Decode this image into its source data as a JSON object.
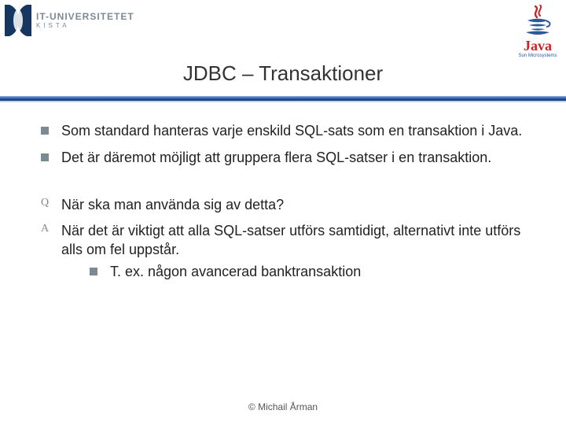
{
  "header": {
    "itu_logo_line1": "IT-UNIVERSITETET",
    "itu_logo_line2": "KISTA",
    "java_wordmark": "Java",
    "java_subline": "Sun Microsystems"
  },
  "title": "JDBC – Transaktioner",
  "bullets": [
    {
      "kind": "square",
      "text": "Som standard hanteras varje enskild SQL-sats som en transaktion i Java."
    },
    {
      "kind": "square",
      "text": "Det är däremot möjligt att gruppera flera SQL-satser i en transaktion."
    }
  ],
  "qa": {
    "q_marker": "Q",
    "q_text": "När ska man använda sig av detta?",
    "a_marker": "A",
    "a_text": "När det är viktigt att alla SQL-satser utförs samtidigt, alternativt inte utförs alls om fel uppstår.",
    "a_sub": "T. ex. någon avancerad banktransaktion"
  },
  "footer": "© Michail Årman"
}
